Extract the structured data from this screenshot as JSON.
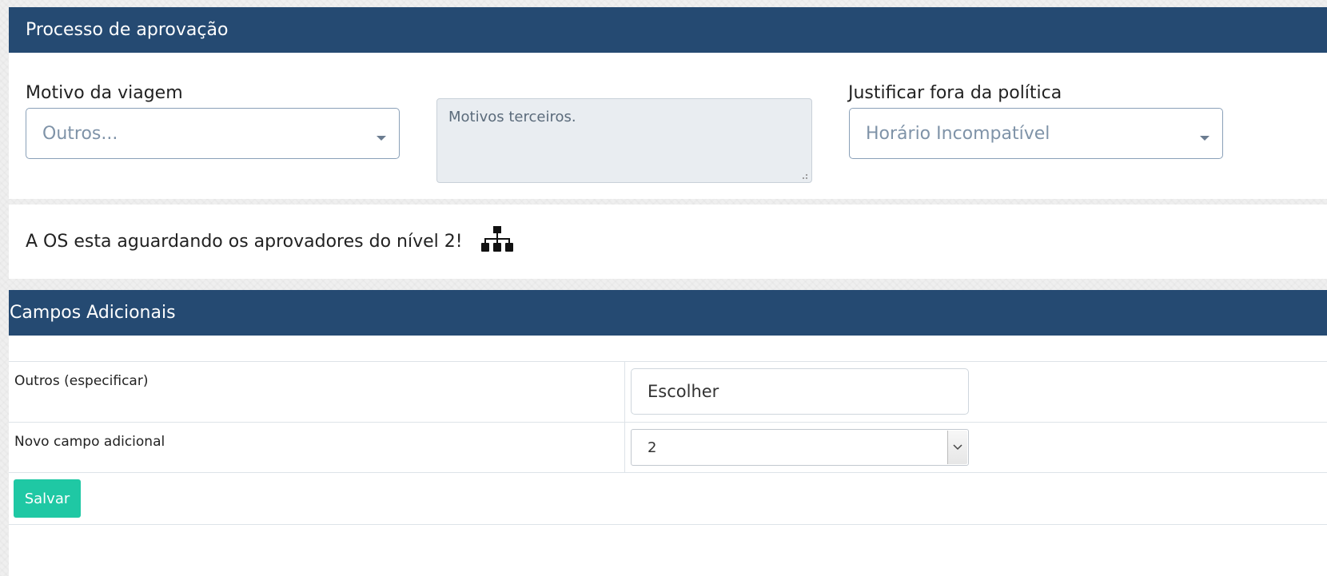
{
  "approval": {
    "header_title": "Processo de aprovação",
    "trip_reason": {
      "label": "Motivo da viagem",
      "value": "Outros..."
    },
    "reason_text": "Motivos terceiros.",
    "policy_justification": {
      "label": "Justificar fora da política",
      "value": "Horário Incompatível"
    }
  },
  "status": {
    "message": "A OS esta aguardando os aprovadores do nível 2!",
    "icon": "hierarchy-icon"
  },
  "extra_fields": {
    "header_title": "Campos Adicionais",
    "rows": [
      {
        "label": "Outros (especificar)",
        "value": "Escolher"
      },
      {
        "label": "Novo campo adicional",
        "value": "2"
      }
    ],
    "save_label": "Salvar"
  },
  "colors": {
    "header_bg": "#254a72",
    "save_button": "#1fc8a4"
  }
}
